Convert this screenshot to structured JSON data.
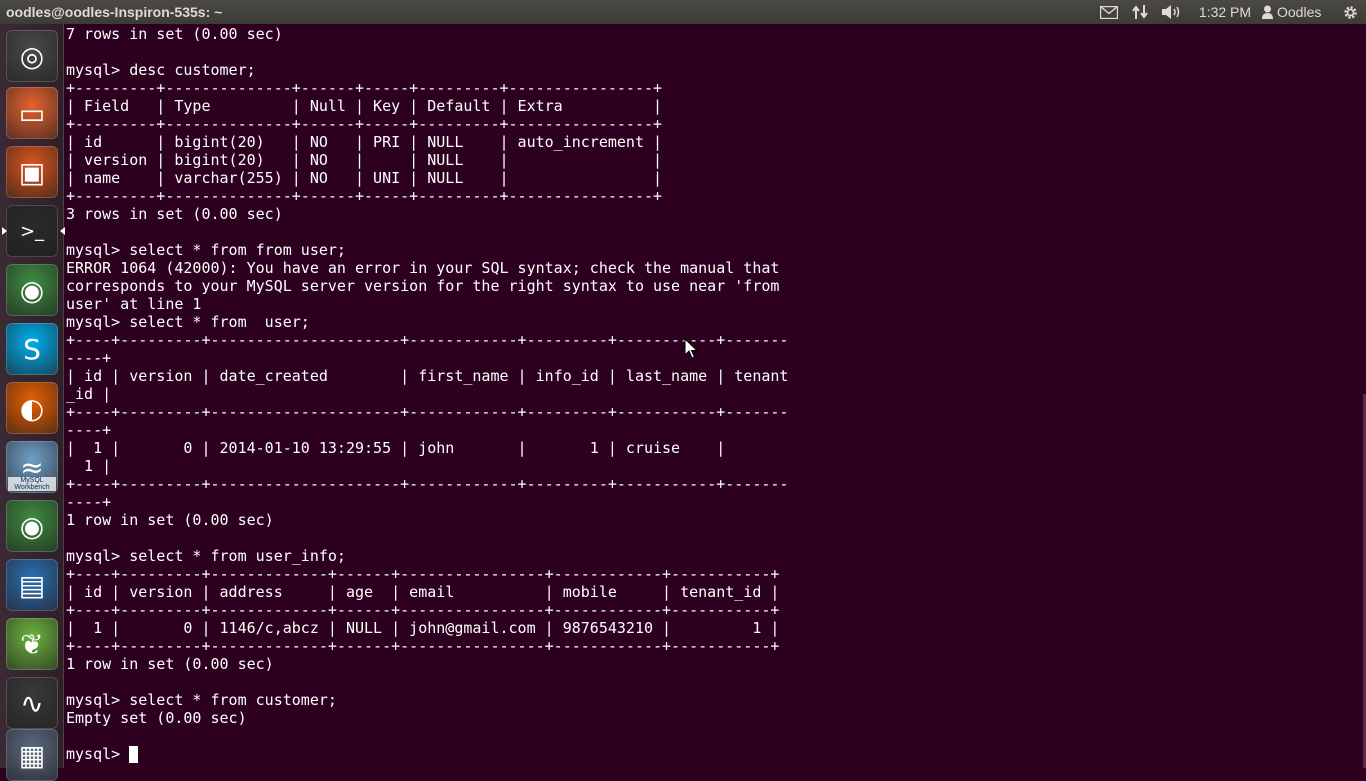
{
  "top_panel": {
    "window_title": "oodles@oodles-Inspiron-535s: ~",
    "clock": "1:32 PM",
    "user_name": "Oodles",
    "tray_icons": [
      "mail-icon",
      "network-arrows-icon",
      "volume-icon",
      "settings-gear-icon"
    ]
  },
  "launcher": {
    "items": [
      {
        "name": "dash-home",
        "icon": "ubuntu-logo-icon",
        "color": "#4a4a4a"
      },
      {
        "name": "files",
        "icon": "folder-icon",
        "color": "#e5632d"
      },
      {
        "name": "software-center",
        "icon": "shopping-bag-icon",
        "color": "#d9541e"
      },
      {
        "name": "terminal",
        "icon": "terminal-icon",
        "color": "#2b2b2b"
      },
      {
        "name": "chrome",
        "icon": "chrome-icon",
        "color": "#3d8c40"
      },
      {
        "name": "skype",
        "icon": "skype-icon",
        "color": "#00aff0"
      },
      {
        "name": "firefox",
        "icon": "firefox-icon",
        "color": "#e66000"
      },
      {
        "name": "mysql-workbench",
        "icon": "dolphin-icon",
        "color": "#6fa0c8",
        "caption": "MySQL Workbench"
      },
      {
        "name": "chrome-2",
        "icon": "chrome-icon",
        "color": "#3d8c40"
      },
      {
        "name": "libreoffice-writer",
        "icon": "document-icon",
        "color": "#2a6fb0"
      },
      {
        "name": "spring-tool-suite",
        "icon": "leaf-icon",
        "color": "#6db33f"
      },
      {
        "name": "system-monitor",
        "icon": "system-monitor-icon",
        "color": "#3a3a3a"
      },
      {
        "name": "workspace-switcher",
        "icon": "workspace-icon",
        "color": "#5a6a80"
      }
    ]
  },
  "terminal": {
    "prompt": "mysql> ",
    "lines": [
      "7 rows in set (0.00 sec)",
      "",
      "mysql> desc customer;",
      "+---------+--------------+------+-----+---------+----------------+",
      "| Field   | Type         | Null | Key | Default | Extra          |",
      "+---------+--------------+------+-----+---------+----------------+",
      "| id      | bigint(20)   | NO   | PRI | NULL    | auto_increment |",
      "| version | bigint(20)   | NO   |     | NULL    |                |",
      "| name    | varchar(255) | NO   | UNI | NULL    |                |",
      "+---------+--------------+------+-----+---------+----------------+",
      "3 rows in set (0.00 sec)",
      "",
      "mysql> select * from from user;",
      "ERROR 1064 (42000): You have an error in your SQL syntax; check the manual that",
      "corresponds to your MySQL server version for the right syntax to use near 'from",
      "user' at line 1",
      "mysql> select * from  user;",
      "+----+---------+---------------------+------------+---------+-----------+-------",
      "----+",
      "| id | version | date_created        | first_name | info_id | last_name | tenant",
      "_id |",
      "+----+---------+---------------------+------------+---------+-----------+-------",
      "----+",
      "|  1 |       0 | 2014-01-10 13:29:55 | john       |       1 | cruise    |",
      "  1 |",
      "+----+---------+---------------------+------------+---------+-----------+-------",
      "----+",
      "1 row in set (0.00 sec)",
      "",
      "mysql> select * from user_info;",
      "+----+---------+-------------+------+----------------+------------+-----------+",
      "| id | version | address     | age  | email          | mobile     | tenant_id |",
      "+----+---------+-------------+------+----------------+------------+-----------+",
      "|  1 |       0 | 1146/c,abcz | NULL | john@gmail.com | 9876543210 |         1 |",
      "+----+---------+-------------+------+----------------+------------+-----------+",
      "1 row in set (0.00 sec)",
      "",
      "mysql> select * from customer;",
      "Empty set (0.00 sec)",
      ""
    ]
  }
}
